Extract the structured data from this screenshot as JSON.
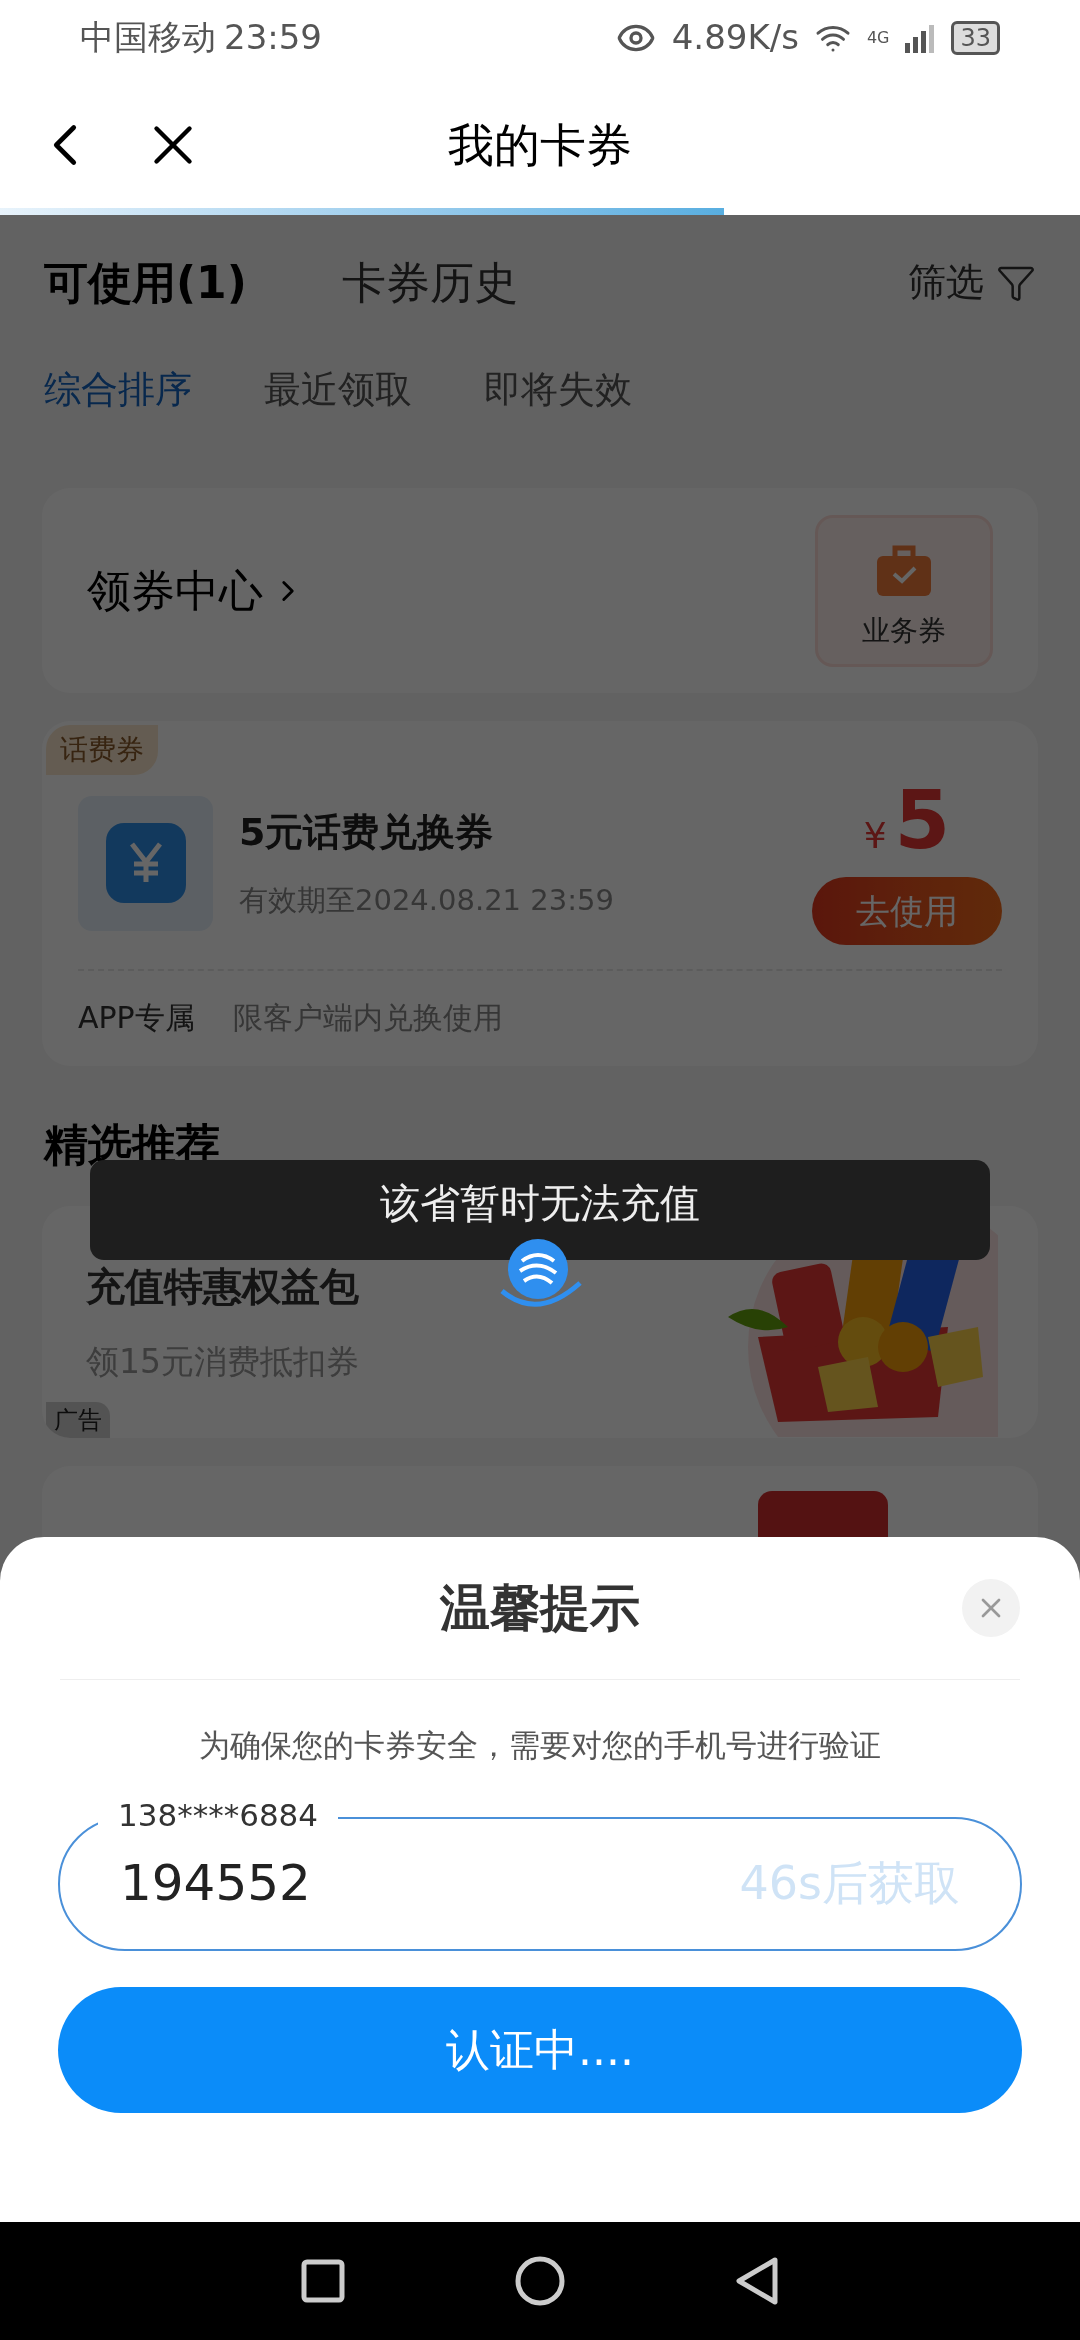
{
  "status_bar": {
    "carrier": "中国移动",
    "time": "23:59",
    "speed": "4.89K/s",
    "network": "4G",
    "battery": "33"
  },
  "header": {
    "title": "我的卡券"
  },
  "tabs": [
    {
      "label": "可使用(1)",
      "selected": true
    },
    {
      "label": "卡券历史",
      "selected": false
    }
  ],
  "filter": {
    "label": "筛选"
  },
  "sort_options": [
    {
      "label": "综合排序",
      "selected": true
    },
    {
      "label": "最近领取",
      "selected": false
    },
    {
      "label": "即将失效",
      "selected": false
    }
  ],
  "coupon_center": {
    "title": "领券中心",
    "badge": "业务券"
  },
  "coupons": [
    {
      "tag": "话费券",
      "title": "5元话费兑换券",
      "validity": "有效期至2024.08.21 23:59",
      "currency": "¥",
      "amount": "5",
      "button": "去使用",
      "notes": [
        "APP专属",
        "限客户端内兑换使用"
      ]
    }
  ],
  "section_title": "精选推荐",
  "promos": [
    {
      "title": "充值特惠权益包",
      "subtitle": "领15元消费抵扣券",
      "ad_label": "广告",
      "kind": "picture"
    },
    {
      "kind": "badge"
    }
  ],
  "toast": {
    "message": "该省暂时无法充值"
  },
  "dialog": {
    "title": "温馨提示",
    "message": "为确保您的卡券安全，需要对您的手机号进行验证",
    "field": {
      "label": "138****6884",
      "value": "194552",
      "countdown": "46s后获取"
    },
    "button": "认证中...."
  }
}
